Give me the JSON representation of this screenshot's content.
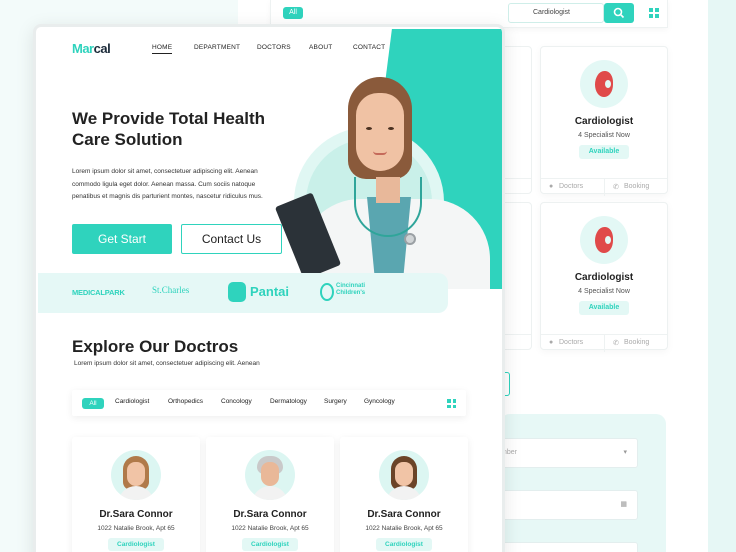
{
  "background_page": {
    "filter": {
      "all_label": "All",
      "search_value": "Cardiologist"
    },
    "cards": [
      {
        "title": "Cardiologist",
        "subtitle": "4 Specialist Now",
        "badge": "Available",
        "doctors_label": "Doctors",
        "booking_label": "Booking"
      },
      {
        "title": "Cardiologist",
        "subtitle": "4 Specialist Now",
        "badge": "Available",
        "doctors_label": "Doctors",
        "booking_label": "Booking"
      }
    ],
    "left_cards": [
      {
        "foot": "oking"
      },
      {
        "foot": "oking"
      }
    ],
    "form_fields": [
      {
        "text": "nber"
      },
      {
        "text": ""
      },
      {
        "text": ""
      }
    ]
  },
  "main": {
    "logo": {
      "part1": "Mar",
      "part2": "cal"
    },
    "nav": [
      "HOME",
      "DEPARTMENT",
      "DOCTORS",
      "ABOUT",
      "CONTACT"
    ],
    "hero": {
      "title": "We Provide Total Health Care Solution",
      "text": "Lorem ipsum dolor sit amet, consectetuer adipiscing elit. Aenean commodo ligula eget dolor. Aenean massa. Cum sociis natoque penatibus et magnis dis parturient montes, nascetur ridiculus mus.",
      "primary_button": "Get Start",
      "secondary_button": "Contact Us"
    },
    "partners": [
      "MEDICALPARK",
      "St.Charles",
      "Pantai",
      "Cincinnati Children's"
    ],
    "section": {
      "title": "Explore Our Doctros",
      "subtitle": "Lorem ipsum dolor sit amet, consectetuer adipiscing elit. Aenean"
    },
    "filter": {
      "all": "All",
      "categories": [
        "Cardiologist",
        "Orthopedics",
        "Concology",
        "Dermatology",
        "Surgery",
        "Gyncology"
      ]
    },
    "doctors": [
      {
        "name": "Dr.Sara Connor",
        "address": "1022 Natalie Brook, Apt 65",
        "specialty": "Cardiologist"
      },
      {
        "name": "Dr.Sara Connor",
        "address": "1022 Natalie Brook, Apt 65",
        "specialty": "Cardiologist"
      },
      {
        "name": "Dr.Sara Connor",
        "address": "1022 Natalie Brook, Apt 65",
        "specialty": "Cardiologist"
      }
    ]
  },
  "colors": {
    "accent": "#2fd3bd",
    "accent_light": "#e3f8f5",
    "text": "#222222"
  }
}
